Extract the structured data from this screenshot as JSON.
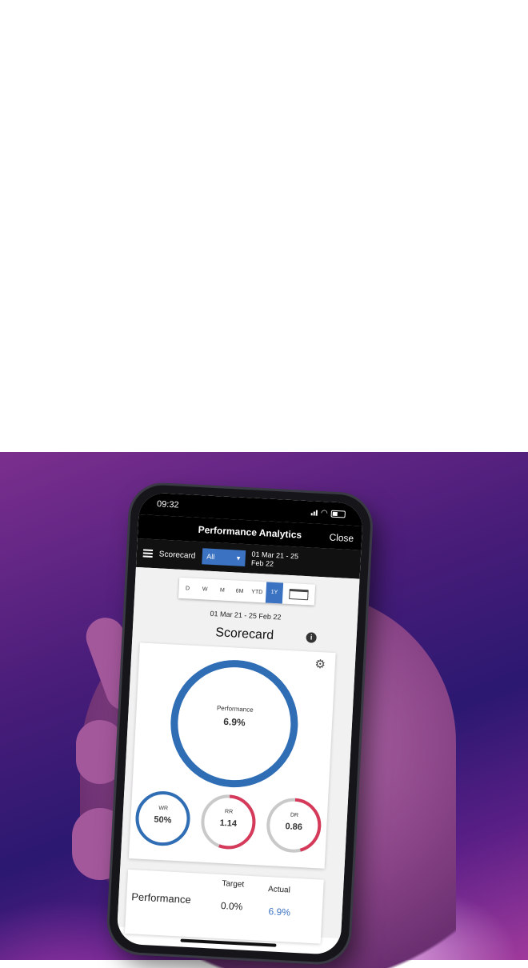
{
  "status": {
    "time": "09:32"
  },
  "header": {
    "title": "Performance Analytics",
    "close_label": "Close"
  },
  "toolbar": {
    "section_label": "Scorecard",
    "filter_value": "All",
    "range": "01 Mar 21  -  25 Feb 22"
  },
  "periods": [
    {
      "label": "D",
      "active": false
    },
    {
      "label": "W",
      "active": false
    },
    {
      "label": "M",
      "active": false
    },
    {
      "label": "6M",
      "active": false
    },
    {
      "label": "YTD",
      "active": false
    },
    {
      "label": "1Y",
      "active": true
    }
  ],
  "date_range": "01 Mar 21  -  25 Feb 22",
  "scorecard": {
    "title": "Scorecard",
    "main": {
      "label": "Performance",
      "value": "6.9%",
      "color": "#2f6db5"
    },
    "gauges": [
      {
        "label": "WR",
        "value": "50%",
        "fill": 1.0,
        "color": "#2f6db5"
      },
      {
        "label": "RR",
        "value": "1.14",
        "fill": 0.55,
        "color": "#d63a5a"
      },
      {
        "label": "DR",
        "value": "0.86",
        "fill": 0.45,
        "color": "#d63a5a"
      }
    ]
  },
  "performance_table": {
    "row_label": "Performance",
    "columns": [
      {
        "header": "Target",
        "value": "0.0%"
      },
      {
        "header": "Actual",
        "value": "6.9%"
      }
    ],
    "actual_color": "#3b73c2"
  }
}
